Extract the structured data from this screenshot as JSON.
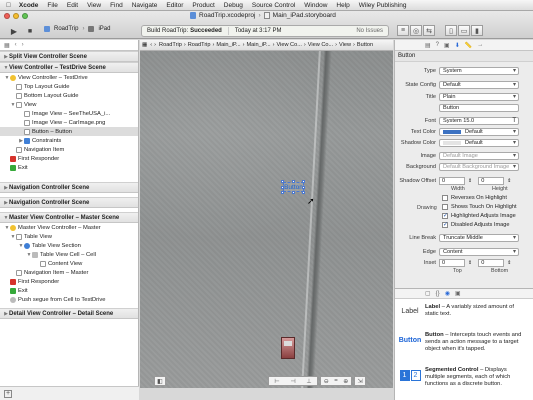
{
  "menubar": {
    "app": "Xcode",
    "items": [
      "File",
      "Edit",
      "View",
      "Find",
      "Navigate",
      "Editor",
      "Product",
      "Debug",
      "Source Control",
      "Window",
      "Help",
      "Wiley Publishing"
    ]
  },
  "toolbar": {
    "file1": "RoadTrip.xcodeproj",
    "file2": "Main_iPad.storyboard",
    "scheme": "RoadTrip",
    "device": "iPad",
    "status_prefix": "Build RoadTrip:",
    "status_result": "Succeeded",
    "status_time": "Today at 3:17 PM",
    "issues": "No Issues"
  },
  "jumpbar": [
    "RoadTrip",
    "RoadTrip",
    "Main_iP...",
    "Main_iP...",
    "View Co...",
    "View Co...",
    "View",
    "Button"
  ],
  "outline": {
    "scene1": "Split View Controller Scene",
    "scene2": "View Controller – TestDrive Scene",
    "vc_td": "View Controller – TestDrive",
    "top_guide": "Top Layout Guide",
    "bottom_guide": "Bottom Layout Guide",
    "view": "View",
    "img1": "Image View – SeeTheUSA_i...",
    "img2": "Image View – CarImage.png",
    "button": "Button – Button",
    "constraints": "Constraints",
    "nav_item": "Navigation Item",
    "first_resp": "First Responder",
    "exit": "Exit",
    "scene3": "Navigation Controller Scene",
    "scene4": "Navigation Controller Scene",
    "scene5": "Master View Controller – Master Scene",
    "mvc": "Master View Controller – Master",
    "table_view": "Table View",
    "table_section": "Table View Section",
    "table_cell": "Table View Cell – Cell",
    "content_view": "Content View",
    "nav_master": "Navigation Item – Master",
    "first_resp2": "First Responder",
    "exit2": "Exit",
    "segue": "Push segue from Cell to TestDrive",
    "scene6": "Detail View Controller – Detail Scene"
  },
  "canvas": {
    "button_label": "Button"
  },
  "inspector": {
    "section": "Button",
    "type_label": "Type",
    "type_val": "System",
    "state_label": "State Config",
    "state_val": "Default",
    "title_label": "Title",
    "title_val": "Plain",
    "title_text": "Button",
    "font_label": "Font",
    "font_val": "System 15.0",
    "textcolor_label": "Text Color",
    "textcolor_val": "Default",
    "shadow_label": "Shadow Color",
    "shadow_val": "Default",
    "image_label": "Image",
    "image_val": "Default Image",
    "bg_label": "Background",
    "bg_val": "Default Background Image",
    "offset_label": "Shadow Offset",
    "offset_x": "0",
    "offset_y": "0",
    "width_lbl": "Width",
    "height_lbl": "Height",
    "reverses": "Reverses On Highlight",
    "drawing_label": "Drawing",
    "shows_touch": "Shows Touch On Highlight",
    "highlighted": "Highlighted Adjusts Image",
    "disabled": "Disabled Adjusts Image",
    "linebreak_label": "Line Break",
    "linebreak_val": "Truncate Middle",
    "edge_label": "Edge",
    "edge_val": "Content",
    "inset_label": "Inset",
    "inset_top_val": "0",
    "inset_bottom_val": "0",
    "top_lbl": "Top",
    "bottom_lbl": "Bottom"
  },
  "library": {
    "label_icon": "Label",
    "label_title": "Label",
    "label_desc": " – A variably sized amount of static text.",
    "button_icon": "Button",
    "button_title": "Button",
    "button_desc": " – Intercepts touch events and sends an action message to a target object when it's tapped.",
    "seg_icon1": "1",
    "seg_icon2": "2",
    "seg_title": "Segmented Control",
    "seg_desc": " – Displays multiple segments, each of which functions as a discrete button."
  }
}
